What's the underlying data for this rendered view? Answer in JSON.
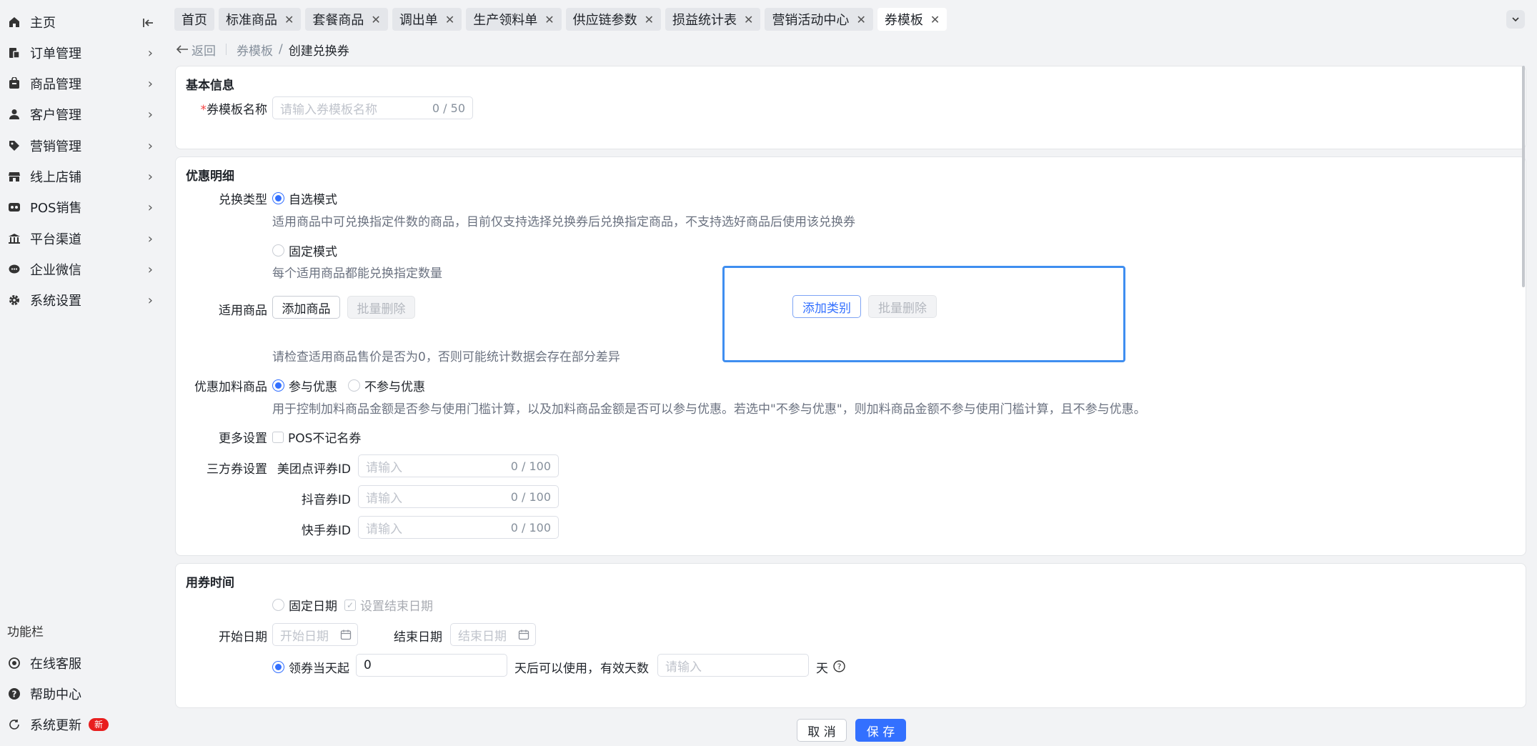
{
  "sidebar": {
    "items": [
      {
        "label": "主页",
        "icon": "home-icon",
        "has_arrow": false
      },
      {
        "label": "订单管理",
        "icon": "order-icon",
        "has_arrow": true
      },
      {
        "label": "商品管理",
        "icon": "goods-icon",
        "has_arrow": true
      },
      {
        "label": "客户管理",
        "icon": "user-icon",
        "has_arrow": true
      },
      {
        "label": "营销管理",
        "icon": "tag-icon",
        "has_arrow": true
      },
      {
        "label": "线上店铺",
        "icon": "shop-icon",
        "has_arrow": true
      },
      {
        "label": "POS销售",
        "icon": "pos-icon",
        "has_arrow": true
      },
      {
        "label": "平台渠道",
        "icon": "channel-icon",
        "has_arrow": true
      },
      {
        "label": "企业微信",
        "icon": "wechat-icon",
        "has_arrow": true
      },
      {
        "label": "系统设置",
        "icon": "gear-icon",
        "has_arrow": true
      }
    ],
    "func_title": "功能栏",
    "func_items": [
      {
        "label": "在线客服",
        "icon": "support-icon"
      },
      {
        "label": "帮助中心",
        "icon": "help-icon"
      },
      {
        "label": "系统更新",
        "icon": "refresh-icon",
        "badge": "新"
      }
    ]
  },
  "tabs": [
    {
      "label": "首页",
      "closable": false,
      "active": false
    },
    {
      "label": "标准商品",
      "closable": true,
      "active": false
    },
    {
      "label": "套餐商品",
      "closable": true,
      "active": false
    },
    {
      "label": "调出单",
      "closable": true,
      "active": false
    },
    {
      "label": "生产领料单",
      "closable": true,
      "active": false
    },
    {
      "label": "供应链参数",
      "closable": true,
      "active": false
    },
    {
      "label": "损益统计表",
      "closable": true,
      "active": false
    },
    {
      "label": "营销活动中心",
      "closable": true,
      "active": false
    },
    {
      "label": "券模板",
      "closable": true,
      "active": true
    }
  ],
  "breadcrumb": {
    "back": "返回",
    "parent": "券模板",
    "sep": "/",
    "current": "创建兑换券"
  },
  "basic": {
    "title": "基本信息",
    "name_label": "券模板名称",
    "name_required": "*",
    "name_placeholder": "请输入券模板名称",
    "name_count": "0 / 50"
  },
  "discount": {
    "title": "优惠明细",
    "exchange_label": "兑换类型",
    "mode_optional": "自选模式",
    "mode_optional_hint": "适用商品中可兑换指定件数的商品，目前仅支持选择兑换券后兑换指定商品，不支持选好商品后使用该兑换券",
    "mode_fixed": "固定模式",
    "mode_fixed_hint": "每个适用商品都能兑换指定数量",
    "goods_label": "适用商品",
    "add_goods": "添加商品",
    "batch_delete": "批量删除",
    "add_category": "添加类别",
    "batch_delete_2": "批量删除",
    "goods_hint": "请检查适用商品售价是否为0，否则可能统计数据会存在部分差异",
    "addon_label": "优惠加料商品",
    "addon_yes": "参与优惠",
    "addon_no": "不参与优惠",
    "addon_hint": "用于控制加料商品金额是否参与使用门槛计算，以及加料商品金额是否可以参与优惠。若选中\"不参与优惠\"，则加料商品金额不参与使用门槛计算，且不参与优惠。",
    "more_label": "更多设置",
    "pos_anonymous": "POS不记名券",
    "third_label": "三方券设置",
    "meituan_label": "美团点评券ID",
    "douyin_label": "抖音券ID",
    "kuaishou_label": "快手券ID",
    "third_placeholder": "请输入",
    "third_count": "0 / 100"
  },
  "usage": {
    "title": "用券时间",
    "fixed_date": "固定日期",
    "set_end_date": "设置结束日期",
    "start_label": "开始日期",
    "start_placeholder": "开始日期",
    "end_label": "结束日期",
    "end_placeholder": "结束日期",
    "from_receive": "领券当天起",
    "days_after_value": "0",
    "days_after_text": "天后可以使用，",
    "valid_days_label": "有效天数",
    "valid_days_placeholder": "请输入",
    "day_unit": "天"
  },
  "footer": {
    "cancel": "取 消",
    "save": "保 存"
  },
  "colors": {
    "primary": "#3370ff",
    "required": "#f53f3f",
    "badge": "#e81e1e",
    "focus_outline": "#3f8ef0"
  }
}
